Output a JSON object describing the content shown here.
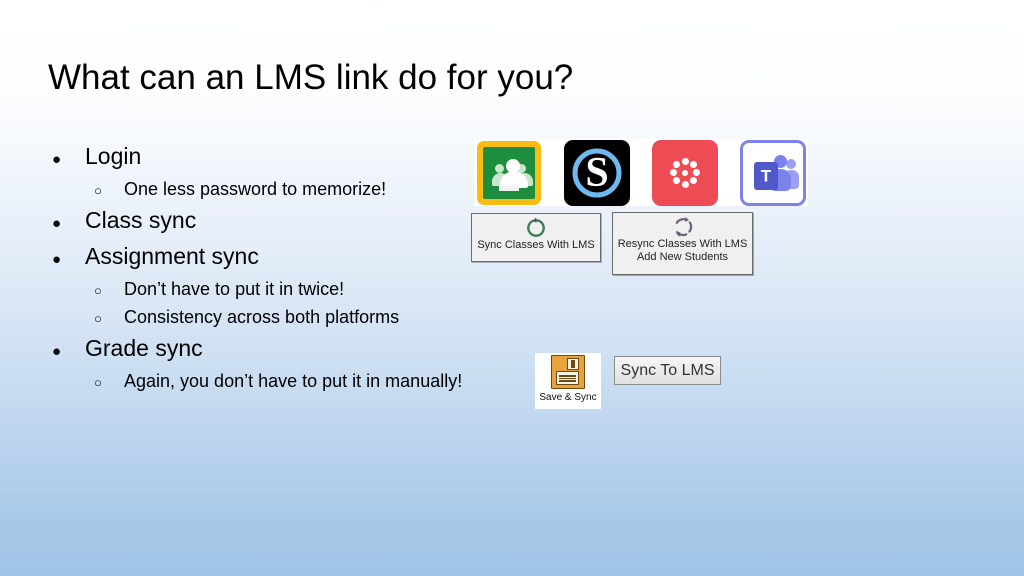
{
  "slide": {
    "title": "What can an LMS link do for you?",
    "background": {
      "top_color": "#ffffff",
      "bottom_color": "#9fc4e6"
    }
  },
  "bullets": [
    {
      "level": 1,
      "marker": "●",
      "text": "Login"
    },
    {
      "level": 2,
      "marker": "○",
      "text": "One less password to memorize!"
    },
    {
      "level": 1,
      "marker": "●",
      "text": "Class sync"
    },
    {
      "level": 1,
      "marker": "●",
      "text": "Assignment sync"
    },
    {
      "level": 2,
      "marker": "○",
      "text": "Don’t have to put it in twice!"
    },
    {
      "level": 2,
      "marker": "○",
      "text": "Consistency across both platforms"
    },
    {
      "level": 1,
      "marker": "●",
      "text": "Grade sync"
    },
    {
      "level": 2,
      "marker": "○",
      "text": "Again, you don’t have to put it in manually!"
    }
  ],
  "app_icons": [
    {
      "name": "google-classroom-icon",
      "label": "Google Classroom",
      "letter": "",
      "colors": {
        "frame": "#f9bc15",
        "board": "#1e8e3e"
      }
    },
    {
      "name": "schoology-icon",
      "label": "Schoology",
      "letter": "S",
      "colors": {
        "bg": "#000000",
        "ring": "#6ebaf0"
      }
    },
    {
      "name": "canvas-icon",
      "label": "Canvas",
      "letter": "",
      "colors": {
        "bg": "#ef4b55",
        "logo": "#ffffff"
      }
    },
    {
      "name": "microsoft-teams-icon",
      "label": "Microsoft Teams",
      "letter": "T",
      "colors": {
        "border": "#7b83eb",
        "box": "#5059c9"
      }
    }
  ],
  "sync_classes_button": {
    "label": "Sync Classes With LMS",
    "icon": "circular-arrow-icon",
    "icon_color": "#3f7d58"
  },
  "resync_classes_button": {
    "label_line1": "Resync Classes With LMS",
    "label_line2": "Add New Students",
    "icon": "dashed-circular-arrows-icon",
    "icon_color": "#6b5f7a"
  },
  "save_sync_button": {
    "label": "Save & Sync",
    "icon": "floppy-disk-icon",
    "icon_color": "#e8a33d"
  },
  "sync_to_lms_button": {
    "label": "Sync To LMS"
  }
}
